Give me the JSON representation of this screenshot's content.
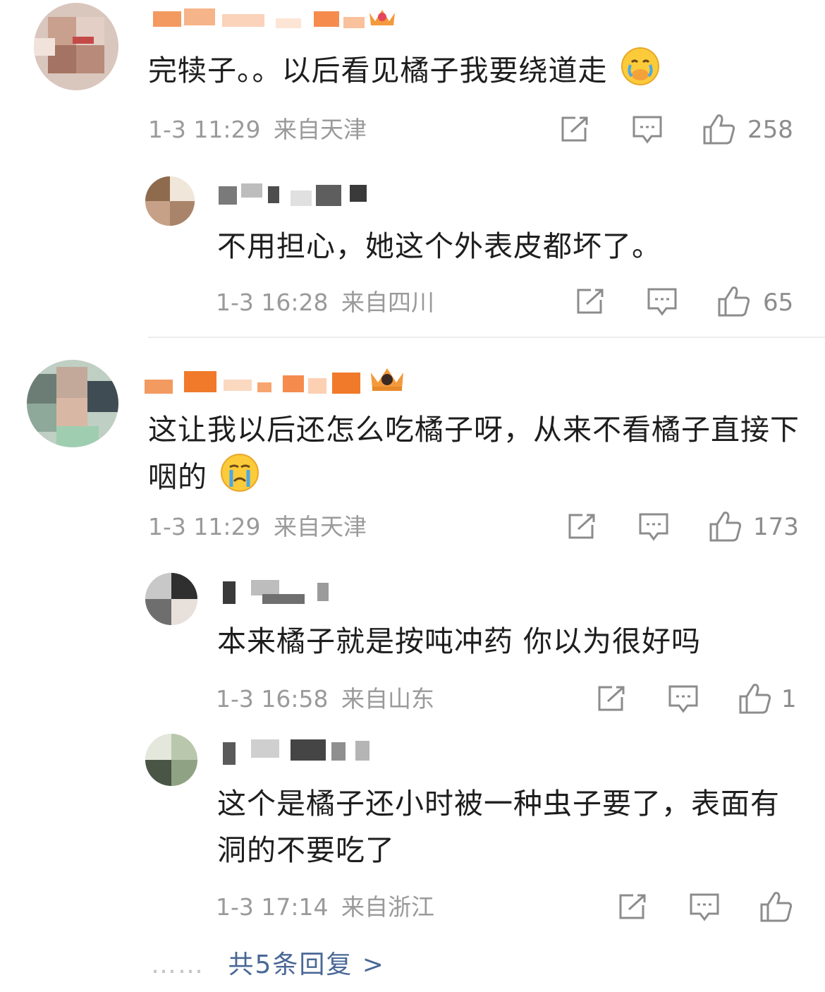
{
  "comments": [
    {
      "text": "完犊子。。以后看见橘子我要绕道走",
      "emoji": "crying-face-emoji",
      "time": "1-3 11:29",
      "location": "来自天津",
      "likes": "258",
      "badge": "crown-badge"
    },
    {
      "text": "不用担心，她这个外表皮都坏了。",
      "time": "1-3 16:28",
      "location": "来自四川",
      "likes": "65"
    },
    {
      "text": "这让我以后还怎么吃橘子呀，从来不看橘子直接下咽的",
      "emoji": "tearful-face-emoji",
      "time": "1-3 11:29",
      "location": "来自天津",
      "likes": "173",
      "badge": "crown-badge"
    },
    {
      "text": "本来橘子就是按吨冲药 你以为很好吗",
      "time": "1-3 16:58",
      "location": "来自山东",
      "likes": "1"
    },
    {
      "text": "这个是橘子还小时被一种虫子要了，表面有洞的不要吃了",
      "time": "1-3 17:14",
      "location": "来自浙江",
      "likes": ""
    }
  ],
  "more_replies": {
    "dots": "……",
    "label": "共5条回复 >"
  },
  "colors": {
    "background": "#ffffff",
    "meta_text": "#9a9a9a",
    "link": "#4a6896",
    "username_orange": "#f07a2a"
  }
}
